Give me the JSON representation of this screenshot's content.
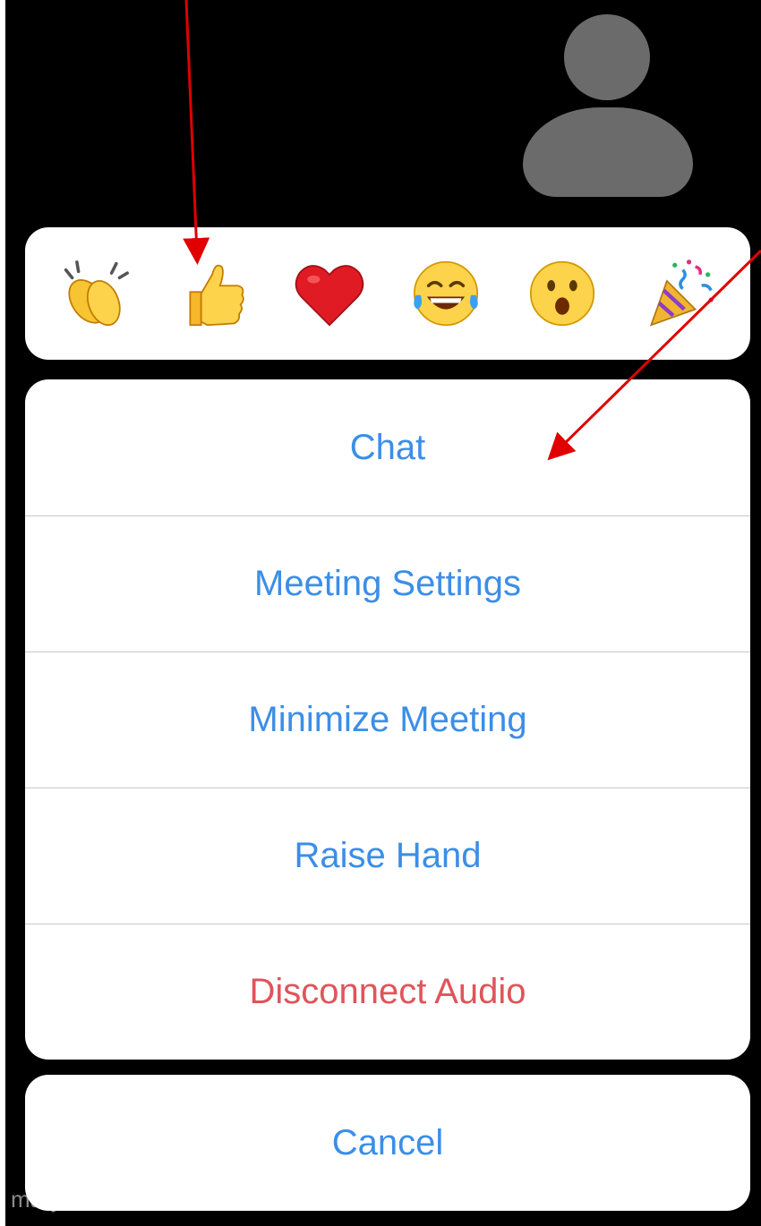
{
  "participant": {
    "name": "mary anne"
  },
  "reactions": [
    {
      "name": "clap-icon"
    },
    {
      "name": "thumbs-up-icon"
    },
    {
      "name": "heart-icon"
    },
    {
      "name": "laughing-tears-icon"
    },
    {
      "name": "surprised-face-icon"
    },
    {
      "name": "party-popper-icon"
    }
  ],
  "menu": {
    "items": [
      {
        "label": "Chat"
      },
      {
        "label": "Meeting Settings"
      },
      {
        "label": "Minimize Meeting"
      },
      {
        "label": "Raise Hand"
      },
      {
        "label": "Disconnect Audio"
      }
    ],
    "cancel_label": "Cancel"
  },
  "colors": {
    "background": "#000000",
    "sheet": "#ffffff",
    "action": "#3b8ee8",
    "destructive": "#e0545a",
    "annotation_arrow": "#e00000"
  }
}
